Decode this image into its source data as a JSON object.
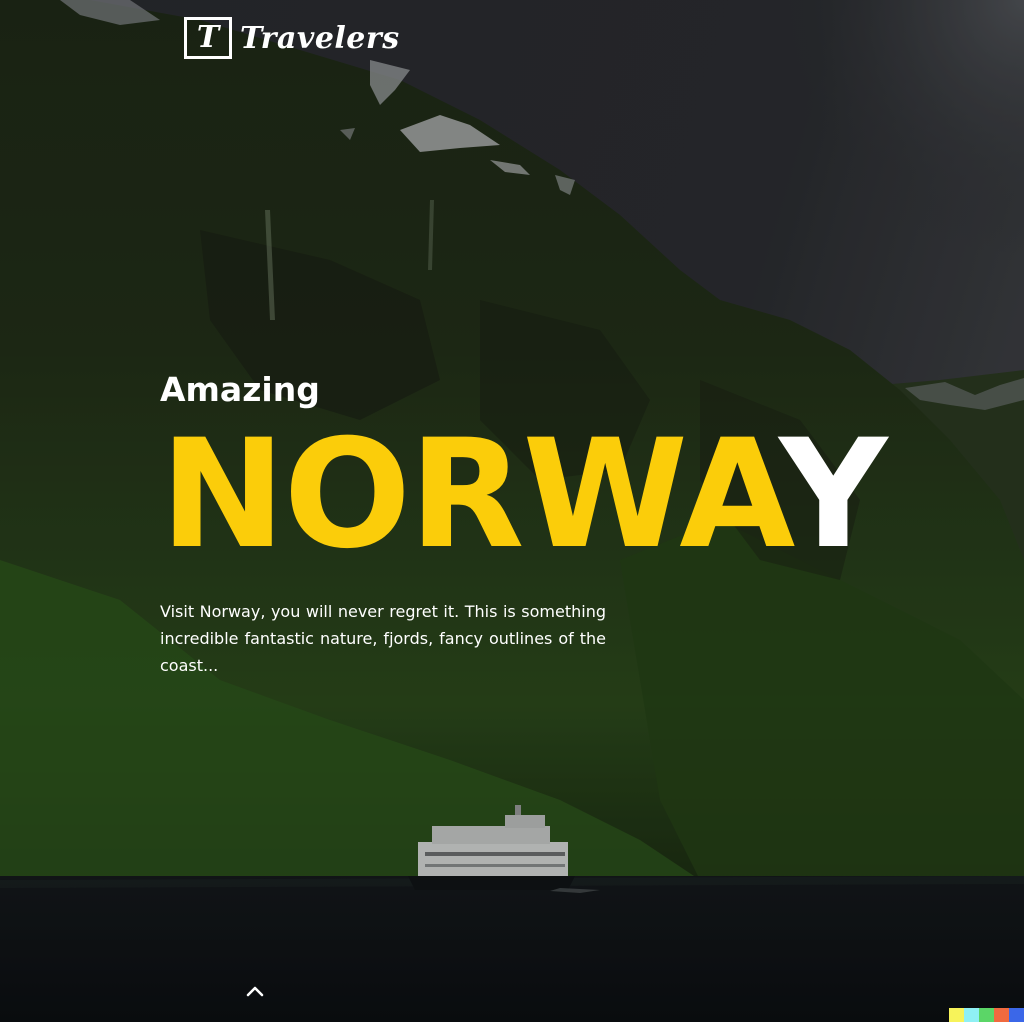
{
  "header": {
    "logo_mark": "T",
    "logo_text": "Travelers"
  },
  "hero": {
    "kicker": "Amazing",
    "headline_primary": "NORWA",
    "headline_accent": "Y",
    "description": "Visit Norway, you will never regret it. This is something incredible fantastic nature, fjords, fancy outlines of the coast..."
  },
  "colors": {
    "headline_yellow": "#fbcd0a",
    "text_white": "#ffffff",
    "sky": "#2d2f33",
    "forest": "#2a3d1b",
    "water": "#101418"
  },
  "icons": {
    "scroll_top": "chevron-up-icon",
    "logo": "t-box-logo"
  },
  "color_bar": [
    "#f7f35a",
    "#8ff0f4",
    "#5bd667",
    "#f06a3f",
    "#3b67e8"
  ]
}
